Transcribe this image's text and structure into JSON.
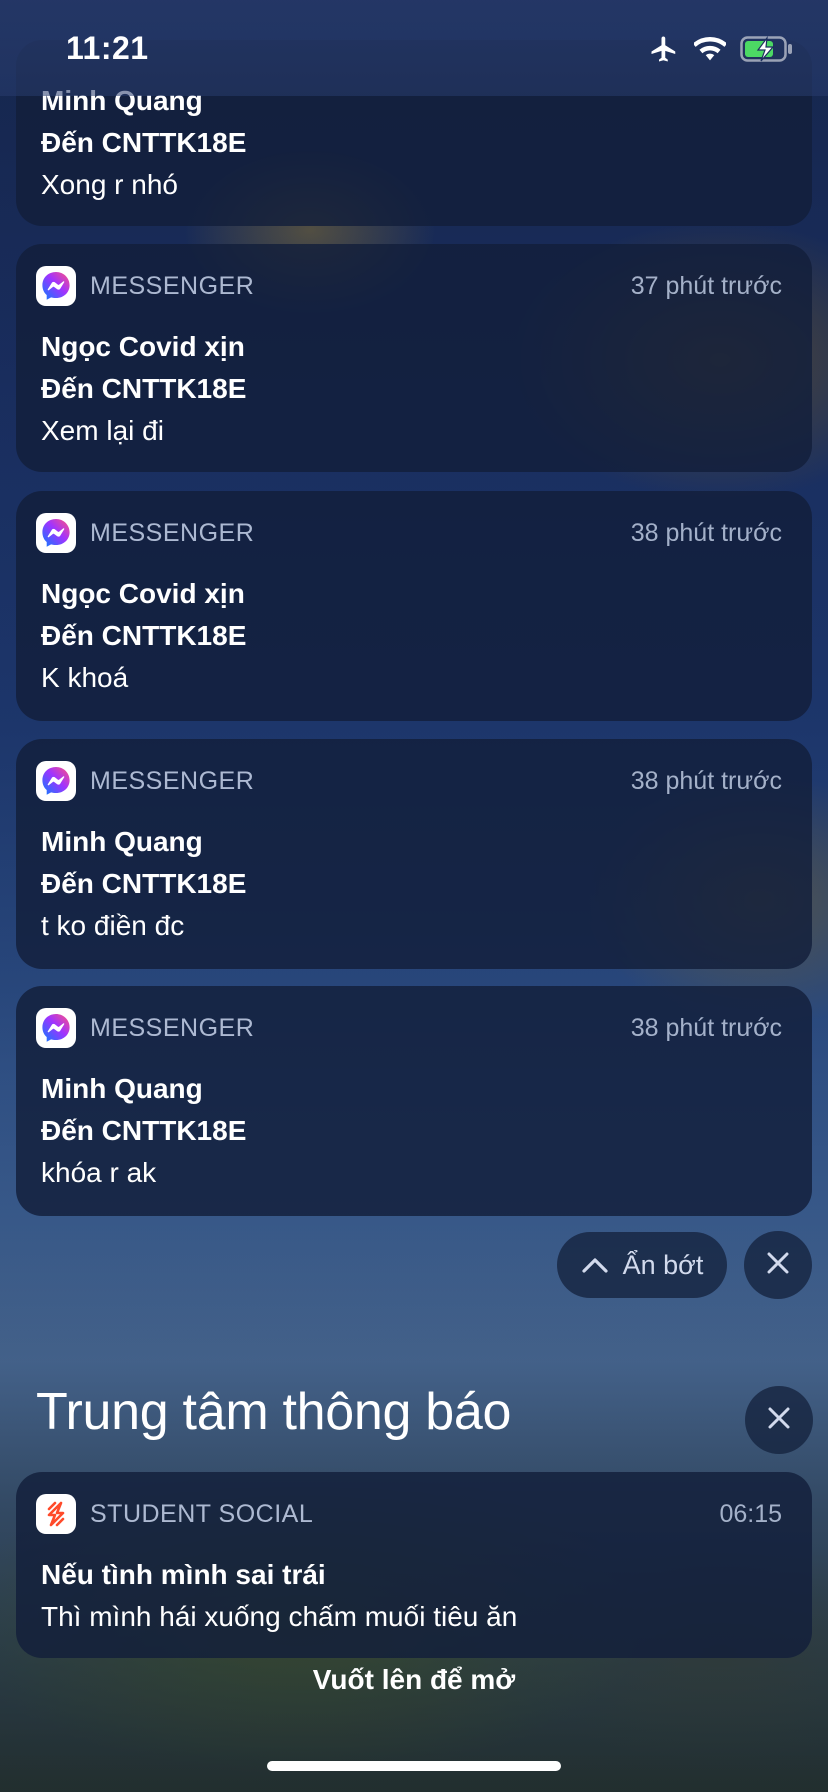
{
  "status_bar": {
    "time": "11:21",
    "icons": [
      "airplane-icon",
      "wifi-icon",
      "battery-charging-icon"
    ],
    "battery_color": "#4cd964"
  },
  "notifications": [
    {
      "app": "",
      "time_ago": "",
      "sender": "Minh Quang",
      "recipient": "Đến CNTTK18E",
      "message": "Xong r nhó",
      "partially_visible": true
    },
    {
      "app": "MESSENGER",
      "time_ago": "37 phút trước",
      "sender": "Ngọc Covid xịn",
      "recipient": "Đến CNTTK18E",
      "message": "Xem lại đi"
    },
    {
      "app": "MESSENGER",
      "time_ago": "38 phút trước",
      "sender": "Ngọc Covid xịn",
      "recipient": "Đến CNTTK18E",
      "message": "K khoá"
    },
    {
      "app": "MESSENGER",
      "time_ago": "38 phút trước",
      "sender": "Minh Quang",
      "recipient": "Đến CNTTK18E",
      "message": "t ko điền đc"
    },
    {
      "app": "MESSENGER",
      "time_ago": "38 phút trước",
      "sender": "Minh Quang",
      "recipient": "Đến CNTTK18E",
      "message": "khóa r ak"
    }
  ],
  "group_controls": {
    "show_less_label": "Ẩn bớt",
    "show_less_icon": "chevron-up-icon",
    "clear_icon": "close-icon"
  },
  "notification_center": {
    "title": "Trung tâm thông báo",
    "clear_icon": "close-icon",
    "items": [
      {
        "app": "STUDENT SOCIAL",
        "time": "06:15",
        "title": "Nếu tình mình sai trái",
        "message": "Thì mình hái xuống chấm muối tiêu ăn"
      }
    ]
  },
  "swipe_hint": "Vuốt lên để mở",
  "colors": {
    "messenger_gradient": [
      "#0a7cff",
      "#a033ff",
      "#ff5280"
    ],
    "student_social_accent": "#ff4a2a"
  }
}
